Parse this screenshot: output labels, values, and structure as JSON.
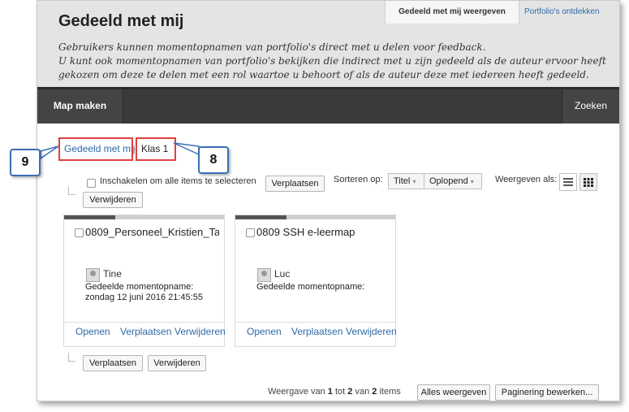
{
  "header": {
    "title": "Gedeeld met mij",
    "description": [
      "Gebruikers kunnen momentopnamen van portfolio's direct met u delen voor feedback.",
      "U kunt ook momentopnamen van portfolio's bekijken die indirect met u zijn gedeeld als de auteur ervoor heeft",
      "gekozen om deze te delen met een rol waartoe u behoort of als de auteur deze met iedereen heeft gedeeld."
    ],
    "tabs": [
      {
        "label": "Gedeeld met mij weergeven",
        "active": true
      },
      {
        "label": "Portfolio's ontdekken",
        "active": false
      }
    ]
  },
  "toolbar": {
    "create_folder": "Map maken",
    "search": "Zoeken"
  },
  "breadcrumb": {
    "root": "Gedeeld met mij",
    "separator": "›",
    "current": "Klas 1"
  },
  "callouts": {
    "breadcrumb_root": "9",
    "breadcrumb_current": "8"
  },
  "bulk": {
    "select_all_label": "Inschakelen om alle items te selecteren",
    "move": "Verplaatsen",
    "delete": "Verwijderen"
  },
  "sort": {
    "label": "Sorteren op:",
    "field": "Titel",
    "order": "Oplopend"
  },
  "view": {
    "label": "Weergeven als:",
    "list_icon": "list-view-icon",
    "grid_icon": "grid-view-icon",
    "selected": "grid"
  },
  "cards": [
    {
      "title": "0809_Personeel_Kristien_Ta",
      "owner": "Tine",
      "shared_label": "Gedeelde momentopname:",
      "shared_date": "zondag 12 juni 2016 21:45:55",
      "progress": 0.32,
      "actions": [
        "Openen",
        "Verplaatsen",
        "Verwijderen"
      ]
    },
    {
      "title": "0809 SSH e-leermap",
      "owner": "Luc",
      "shared_label": "Gedeelde momentopname:",
      "shared_date": "",
      "progress": 0.32,
      "actions": [
        "Openen",
        "Verplaatsen",
        "Verwijderen"
      ]
    }
  ],
  "footer": {
    "prefix": "Weergave van",
    "from": "1",
    "to_word": "tot",
    "to": "2",
    "of_word": "van",
    "total": "2",
    "items_word": "items",
    "show_all": "Alles weergeven",
    "edit_paging": "Paginering bewerken..."
  },
  "colors": {
    "highlight": "#e04040",
    "callout_border": "#3a6fb5",
    "link": "#2e6aa8"
  }
}
